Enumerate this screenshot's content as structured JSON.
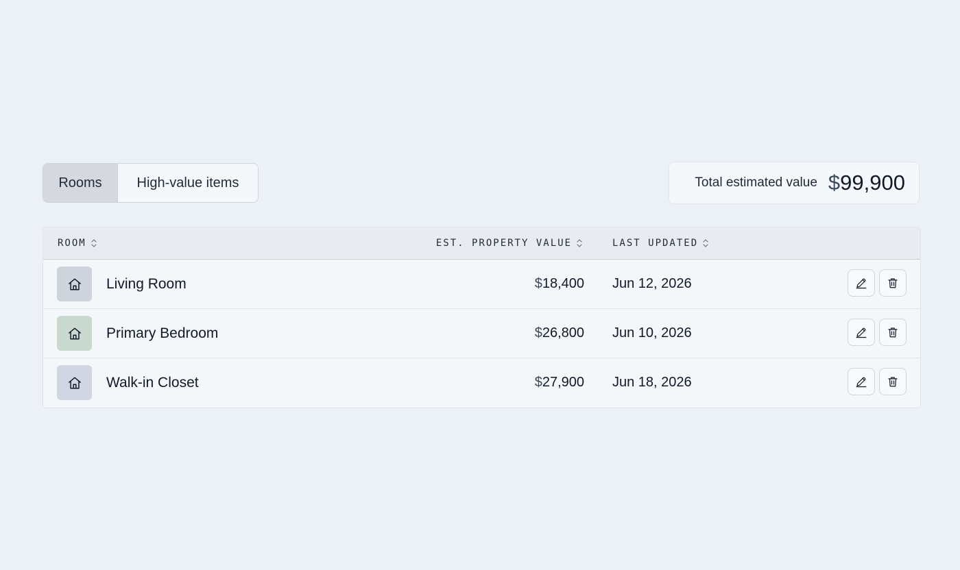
{
  "tabs": {
    "rooms_label": "Rooms",
    "items_label": "High-value items",
    "active": "Rooms"
  },
  "summary": {
    "label": "Total estimated value",
    "currency": "$",
    "amount": "99,900"
  },
  "table": {
    "columns": {
      "room": "ROOM",
      "value": "EST. PROPERTY VALUE",
      "updated": "LAST UPDATED"
    },
    "rows": [
      {
        "name": "Living Room",
        "currency": "$",
        "value": "18,400",
        "updated": "Jun 12, 2026",
        "icon": "home-icon",
        "icon_bg": "#cdd4dc"
      },
      {
        "name": "Primary Bedroom",
        "currency": "$",
        "value": "26,800",
        "updated": "Jun 10, 2026",
        "icon": "home-icon",
        "icon_bg": "#cad9cf"
      },
      {
        "name": "Walk-in Closet",
        "currency": "$",
        "value": "27,900",
        "updated": "Jun 18, 2026",
        "icon": "home-icon",
        "icon_bg": "#d0d7e3"
      }
    ]
  },
  "row_actions": [
    "edit-icon",
    "trash-icon"
  ]
}
